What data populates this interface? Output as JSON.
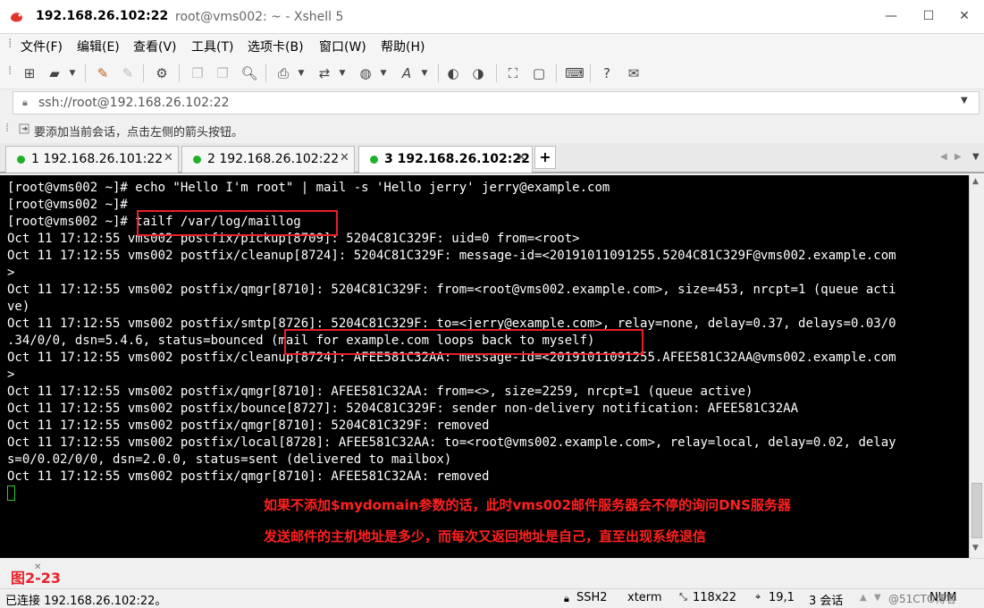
{
  "window": {
    "title_host": "192.168.26.102:22",
    "title_rest": "root@vms002: ~ - Xshell 5",
    "minimize": "—",
    "maximize": "☐",
    "close": "✕"
  },
  "menu": [
    "文件(F)",
    "编辑(E)",
    "查看(V)",
    "工具(T)",
    "选项卡(B)",
    "窗口(W)",
    "帮助(H)"
  ],
  "address": {
    "url": "ssh://root@192.168.26.102:22"
  },
  "hint": {
    "text": "要添加当前会话，点击左侧的箭头按钮。"
  },
  "tabs": [
    {
      "label": "1 192.168.26.101:22",
      "active": false
    },
    {
      "label": "2 192.168.26.102:22",
      "active": false
    },
    {
      "label": "3 192.168.26.102:22",
      "active": true
    }
  ],
  "terminal": {
    "lines": [
      "[root@vms002 ~]# echo \"Hello I'm root\" | mail -s 'Hello jerry' jerry@example.com",
      "[root@vms002 ~]#",
      "[root@vms002 ~]# tailf /var/log/maillog",
      "Oct 11 17:12:55 vms002 postfix/pickup[8709]: 5204C81C329F: uid=0 from=<root>",
      "Oct 11 17:12:55 vms002 postfix/cleanup[8724]: 5204C81C329F: message-id=<20191011091255.5204C81C329F@vms002.example.com",
      ">",
      "Oct 11 17:12:55 vms002 postfix/qmgr[8710]: 5204C81C329F: from=<root@vms002.example.com>, size=453, nrcpt=1 (queue acti",
      "ve)",
      "Oct 11 17:12:55 vms002 postfix/smtp[8726]: 5204C81C329F: to=<jerry@example.com>, relay=none, delay=0.37, delays=0.03/0",
      ".34/0/0, dsn=5.4.6, status=bounced (mail for example.com loops back to myself)",
      "Oct 11 17:12:55 vms002 postfix/cleanup[8724]: AFEE581C32AA: message-id=<20191011091255.AFEE581C32AA@vms002.example.com",
      ">",
      "Oct 11 17:12:55 vms002 postfix/qmgr[8710]: AFEE581C32AA: from=<>, size=2259, nrcpt=1 (queue active)",
      "Oct 11 17:12:55 vms002 postfix/bounce[8727]: 5204C81C329F: sender non-delivery notification: AFEE581C32AA",
      "Oct 11 17:12:55 vms002 postfix/qmgr[8710]: 5204C81C329F: removed",
      "Oct 11 17:12:55 vms002 postfix/local[8728]: AFEE581C32AA: to=<root@vms002.example.com>, relay=local, delay=0.02, delay",
      "s=0/0.02/0/0, dsn=2.0.0, status=sent (delivered to mailbox)",
      "Oct 11 17:12:55 vms002 postfix/qmgr[8710]: AFEE581C32AA: removed"
    ],
    "annotation_line1": "如果不添加$mydomain参数的话，此时vms002邮件服务器会不停的询问DNS服务器",
    "annotation_line2": "发送邮件的主机地址是多少，而每次又返回地址是自己，直至出现系统退信"
  },
  "figure_label": "图2-23",
  "status": {
    "connection": "已连接 192.168.26.102:22。",
    "protocol": "SSH2",
    "term": "xterm",
    "size": "118x22",
    "position": "19,1",
    "sessions": "3 会话",
    "mode": "NUM",
    "watermark": "@51CTO博客"
  },
  "colors": {
    "terminal_bg": "#000000",
    "highlight": "#e8202a",
    "annotation": "#ff2020",
    "tab_dot": "#21b02a"
  }
}
